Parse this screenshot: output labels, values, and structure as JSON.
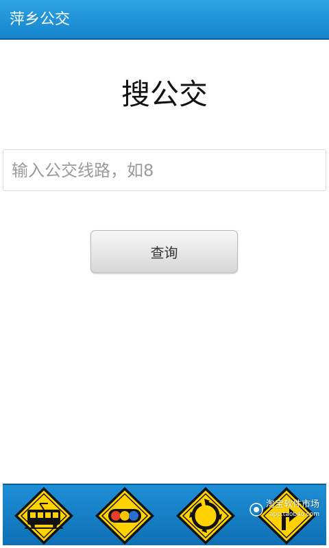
{
  "app": {
    "title": "萍乡公交"
  },
  "main": {
    "heading": "搜公交",
    "search": {
      "value": "",
      "placeholder": "输入公交线路，如8"
    },
    "query_button": "查询"
  },
  "bottom_nav": {
    "items": [
      {
        "icon": "tram-sign-icon"
      },
      {
        "icon": "traffic-light-sign-icon"
      },
      {
        "icon": "roundabout-sign-icon"
      },
      {
        "icon": "turn-arrow-sign-icon"
      }
    ]
  },
  "watermark": {
    "title": "淘宝软件市场",
    "url": "app.taobao.com"
  },
  "colors": {
    "titlebar": "#1e92d8",
    "sign_fill": "#ffd200",
    "sign_border": "#111111"
  }
}
